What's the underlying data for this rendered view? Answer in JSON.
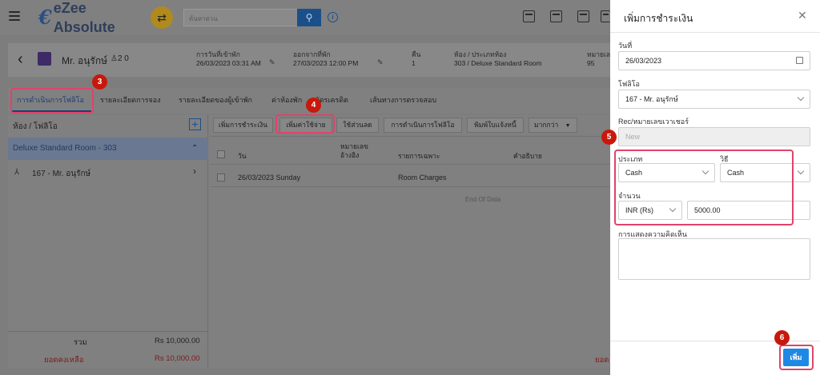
{
  "topbar": {
    "logo_text": "eZee Absolute",
    "search_placeholder": "ค้นหาด่วน"
  },
  "guest": {
    "name": "Mr. อนุรักษ์",
    "counts": "2  0",
    "fields": [
      {
        "label": "การวันที่เข้าพัก",
        "value": "26/03/2023 03:31 AM"
      },
      {
        "label": "ออกจากที่พัก",
        "value": "27/03/2023 12:00 PM"
      },
      {
        "label": "คืน",
        "value": "1"
      },
      {
        "label": "ห้อง / ประเภทห้อง",
        "value": "303 / Deluxe Standard Room"
      },
      {
        "label": "หมายเล",
        "value": "95"
      }
    ]
  },
  "tabs": [
    {
      "label": "การดำเนินการโฟลิโอ",
      "active": true
    },
    {
      "label": "รายละเอียดการจอง"
    },
    {
      "label": "รายละเอียดของผู้เข้าพัก"
    },
    {
      "label": "ค่าห้องพัก"
    },
    {
      "label": "บัตรเครดิต"
    },
    {
      "label": "เส้นทางการตรวจสอบ"
    }
  ],
  "left": {
    "title": "ห้อง / โฟลิโอ",
    "room": "Deluxe Standard Room - 303",
    "guest_folio": "167 - Mr. อนุรักษ์",
    "total_label": "รวม",
    "total_value": "Rs 10,000.00",
    "balance_label": "ยอดคงเหลือ",
    "balance_value": "Rs 10,000.00"
  },
  "toolbar": {
    "add_payment": "เพิ่มการชำระเงิน",
    "add_expense": "เพิ่มค่าใช้จ่าย",
    "discount": "ใช้ส่วนลด",
    "folio_ops": "การดำเนินการโฟลิโอ",
    "print": "พิมพ์ใบแจ้งหนี้",
    "more": "มากกว่า"
  },
  "table": {
    "headers": [
      "วัน",
      "หมายเลข อ้างอิง",
      "รายการเฉพาะ",
      "คำอธิบาย"
    ],
    "rows": [
      {
        "date": "26/03/2023 Sunday",
        "ref": "",
        "item": "Room Charges",
        "desc": ""
      }
    ],
    "end_text": "End Of Data",
    "balance_right": "ยอด"
  },
  "drawer": {
    "title": "เพิ่มการชำระเงิน",
    "date_label": "วันที่",
    "date_value": "26/03/2023",
    "folio_label": "โฟลิโอ",
    "folio_value": "167 - Mr. อนุรักษ์",
    "voucher_label": "Rec/หมายเลขเวาเชอร์",
    "voucher_value": "New",
    "type_label": "ประเภท",
    "type_value": "Cash",
    "method_label": "วิธี",
    "method_value": "Cash",
    "amount_label": "จำนวน",
    "currency_value": "INR (Rs)",
    "amount_value": "5000.00",
    "comment_label": "การแสดงความคิดเห็น",
    "add_button": "เพิ่ม"
  },
  "badges": [
    "3",
    "4",
    "5",
    "6"
  ],
  "colors": {
    "highlight": "#e0436b",
    "badge": "#c8180c",
    "primary": "#1e88e5"
  }
}
